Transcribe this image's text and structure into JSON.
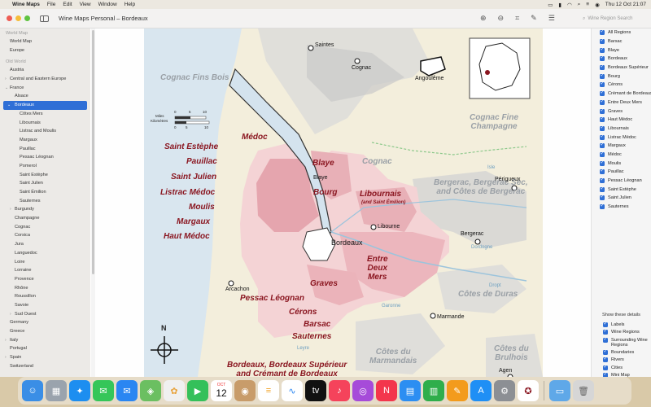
{
  "menubar": {
    "app_name": "Wine Maps",
    "menus": [
      "File",
      "Edit",
      "View",
      "Window",
      "Help"
    ],
    "clock": "Thu 12 Oct  21:07"
  },
  "window": {
    "title": "Wine Maps Personal – Bordeaux",
    "search_placeholder": "Wine Region Search"
  },
  "sidebar": {
    "sections": [
      {
        "label": "World Map",
        "items": [
          {
            "label": "World Map",
            "level": 1
          },
          {
            "label": "Europe",
            "level": 1
          }
        ]
      },
      {
        "label": "Old World",
        "items": [
          {
            "label": "Austria",
            "level": 1
          },
          {
            "label": "Central and Eastern Europe",
            "level": 1,
            "chevron": "›"
          },
          {
            "label": "France",
            "level": 1,
            "chevron": "⌄"
          },
          {
            "label": "Alsace",
            "level": 2
          },
          {
            "label": "Bordeaux",
            "level": 2,
            "chevron": "⌄",
            "selected": true
          },
          {
            "label": "Côtes Mers",
            "level": 3
          },
          {
            "label": "Libournais",
            "level": 3
          },
          {
            "label": "Listrac and Moulis",
            "level": 3
          },
          {
            "label": "Margaux",
            "level": 3
          },
          {
            "label": "Pauillac",
            "level": 3
          },
          {
            "label": "Pessac Léognan",
            "level": 3
          },
          {
            "label": "Pomerol",
            "level": 3
          },
          {
            "label": "Saint Estèphe",
            "level": 3
          },
          {
            "label": "Saint Julien",
            "level": 3
          },
          {
            "label": "Saint Émilion",
            "level": 3
          },
          {
            "label": "Sauternes",
            "level": 3
          },
          {
            "label": "Burgundy",
            "level": 2,
            "chevron": "›"
          },
          {
            "label": "Champagne",
            "level": 2
          },
          {
            "label": "Cognac",
            "level": 2
          },
          {
            "label": "Corsica",
            "level": 2
          },
          {
            "label": "Jura",
            "level": 2
          },
          {
            "label": "Languedoc",
            "level": 2
          },
          {
            "label": "Loire",
            "level": 2
          },
          {
            "label": "Lorraine",
            "level": 2
          },
          {
            "label": "Provence",
            "level": 2
          },
          {
            "label": "Rhône",
            "level": 2
          },
          {
            "label": "Roussillon",
            "level": 2
          },
          {
            "label": "Savoie",
            "level": 2
          },
          {
            "label": "Sud Ouest",
            "level": 2,
            "chevron": "›"
          },
          {
            "label": "Germany",
            "level": 1
          },
          {
            "label": "Greece",
            "level": 1
          },
          {
            "label": "Italy",
            "level": 1,
            "chevron": "›"
          },
          {
            "label": "Portugal",
            "level": 1
          },
          {
            "label": "Spain",
            "level": 1,
            "chevron": "›"
          },
          {
            "label": "Switzerland",
            "level": 1
          }
        ]
      }
    ]
  },
  "map": {
    "scale_miles": "Miles",
    "scale_km": "Kilomètres",
    "scale_ticks_miles": [
      "0",
      "5",
      "10"
    ],
    "scale_ticks_km": [
      "0",
      "5",
      "10"
    ],
    "north": "N",
    "regions_red": {
      "medoc": "Médoc",
      "saint_estephe": "Saint Estèphe",
      "pauillac": "Pauillac",
      "saint_julien": "Saint Julien",
      "listrac": "Listrac Médoc",
      "moulis": "Moulis",
      "margaux": "Margaux",
      "haut_medoc": "Haut Médoc",
      "blaye": "Blaye",
      "bourg": "Bourg",
      "libournais": "Libournais",
      "libournais_sub": "(and Saint Émilion)",
      "entre_deux_mers": "Entre\nDeux\nMers",
      "graves": "Graves",
      "pessac": "Pessac Léognan",
      "cerons": "Cérons",
      "barsac": "Barsac",
      "sauternes": "Sauternes",
      "bordeaux_sup": "Bordeaux, Bordeaux Supérieur\nand Crémant de Bordeaux"
    },
    "regions_grey": {
      "cognac_fins_bois": "Cognac Fins Bois",
      "cognac": "Cognac",
      "cognac_fine": "Cognac Fine\nChampagne",
      "bergerac": "Bergerac, Bergerac Sec,\nand Côtes de Bergerac",
      "cotes_duras": "Côtes de Duras",
      "cotes_marmandais": "Côtes du\nMarmandais",
      "cotes_bruhois": "Côtes du\nBrulhois"
    },
    "towns": {
      "saintes": "Saintes",
      "cognac": "Cognac",
      "angouleme": "Angoulême",
      "perigueux": "Périgueux",
      "blaye": "Blaye",
      "libourne": "Libourne",
      "bordeaux": "Bordeaux",
      "arcachon": "Arcachon",
      "bergerac": "Bergerac",
      "marmande": "Marmande",
      "agen": "Agen"
    },
    "rivers": {
      "isle": "Isle",
      "dordogne": "Dordogne",
      "dropt": "Dropt",
      "garonne": "Garonne",
      "leyre": "Leyre"
    }
  },
  "checklist": {
    "regions": [
      "All Regions",
      "Barsac",
      "Blaye",
      "Bordeaux",
      "Bordeaux Supérieur",
      "Bourg",
      "Cérons",
      "Crémant de Bordeaux",
      "Entre Deux Mers",
      "Graves",
      "Haut Médoc",
      "Libournais",
      "Listrac Médoc",
      "Margaux",
      "Médoc",
      "Moulis",
      "Pauillac",
      "Pessac Léognan",
      "Saint Estèphe",
      "Saint Julien",
      "Sauternes"
    ],
    "details_heading": "Show these details",
    "details": [
      "Labels",
      "Wine Regions",
      "Surrounding Wine Regions",
      "Boundaries",
      "Rivers",
      "Cities",
      "Mini Map"
    ]
  },
  "dock": {
    "calendar_month": "OCT",
    "calendar_day": "12",
    "apps": [
      "finder-icon",
      "launchpad-icon",
      "safari-icon",
      "messages-icon",
      "mail-icon",
      "maps-icon",
      "photos-icon",
      "facetime-icon",
      "calendar-icon",
      "contacts-icon",
      "reminders-icon",
      "freeform-icon",
      "tv-icon",
      "music-icon",
      "podcasts-icon",
      "news-icon",
      "keynote-icon",
      "numbers-icon",
      "pages-icon",
      "app-store-icon",
      "system-settings-icon",
      "wine-maps-icon",
      "downloads-folder-icon",
      "trash-icon"
    ]
  }
}
